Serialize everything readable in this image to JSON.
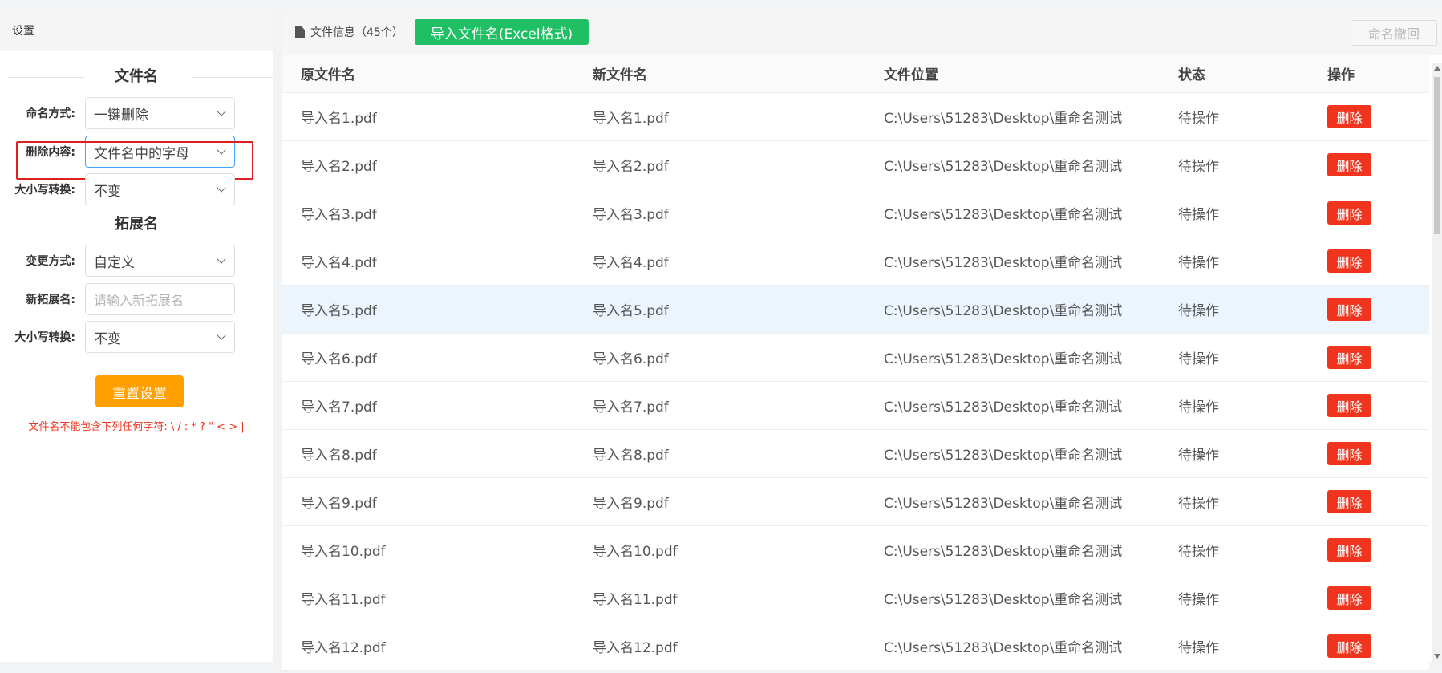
{
  "sidebar": {
    "header": "设置",
    "filename_section": "文件名",
    "extension_section": "拓展名",
    "naming_mode": {
      "label": "命名方式:",
      "value": "一键删除"
    },
    "delete_content": {
      "label": "删除内容:",
      "value": "文件名中的字母"
    },
    "case_convert": {
      "label": "大小写转换:",
      "value": "不变"
    },
    "change_mode": {
      "label": "变更方式:",
      "value": "自定义"
    },
    "new_ext": {
      "label": "新拓展名:",
      "placeholder": "请输入新拓展名"
    },
    "ext_case_convert": {
      "label": "大小写转换:",
      "value": "不变"
    },
    "reset_label": "重置设置",
    "warning": "文件名不能包含下列任何字符: \\ / : * ? \" < > |"
  },
  "main": {
    "file_info": "文件信息（45个）",
    "import_label": "导入文件名(Excel格式)",
    "undo_label": "命名撤回",
    "columns": [
      "原文件名",
      "新文件名",
      "文件位置",
      "状态",
      "操作"
    ],
    "delete_label": "删除",
    "rows": [
      {
        "orig": "导入名1.pdf",
        "new": "导入名1.pdf",
        "path": "C:\\Users\\51283\\Desktop\\重命名测试",
        "status": "待操作"
      },
      {
        "orig": "导入名2.pdf",
        "new": "导入名2.pdf",
        "path": "C:\\Users\\51283\\Desktop\\重命名测试",
        "status": "待操作"
      },
      {
        "orig": "导入名3.pdf",
        "new": "导入名3.pdf",
        "path": "C:\\Users\\51283\\Desktop\\重命名测试",
        "status": "待操作"
      },
      {
        "orig": "导入名4.pdf",
        "new": "导入名4.pdf",
        "path": "C:\\Users\\51283\\Desktop\\重命名测试",
        "status": "待操作"
      },
      {
        "orig": "导入名5.pdf",
        "new": "导入名5.pdf",
        "path": "C:\\Users\\51283\\Desktop\\重命名测试",
        "status": "待操作"
      },
      {
        "orig": "导入名6.pdf",
        "new": "导入名6.pdf",
        "path": "C:\\Users\\51283\\Desktop\\重命名测试",
        "status": "待操作"
      },
      {
        "orig": "导入名7.pdf",
        "new": "导入名7.pdf",
        "path": "C:\\Users\\51283\\Desktop\\重命名测试",
        "status": "待操作"
      },
      {
        "orig": "导入名8.pdf",
        "new": "导入名8.pdf",
        "path": "C:\\Users\\51283\\Desktop\\重命名测试",
        "status": "待操作"
      },
      {
        "orig": "导入名9.pdf",
        "new": "导入名9.pdf",
        "path": "C:\\Users\\51283\\Desktop\\重命名测试",
        "status": "待操作"
      },
      {
        "orig": "导入名10.pdf",
        "new": "导入名10.pdf",
        "path": "C:\\Users\\51283\\Desktop\\重命名测试",
        "status": "待操作"
      },
      {
        "orig": "导入名11.pdf",
        "new": "导入名11.pdf",
        "path": "C:\\Users\\51283\\Desktop\\重命名测试",
        "status": "待操作"
      },
      {
        "orig": "导入名12.pdf",
        "new": "导入名12.pdf",
        "path": "C:\\Users\\51283\\Desktop\\重命名测试",
        "status": "待操作"
      }
    ]
  },
  "icons": {
    "file": "file-icon",
    "dropdown": "chevron-down-icon"
  },
  "colors": {
    "import_button": "#1fbf63",
    "reset_button": "#ff9f00",
    "delete_button": "#f0341e",
    "highlight": "#e02020"
  }
}
